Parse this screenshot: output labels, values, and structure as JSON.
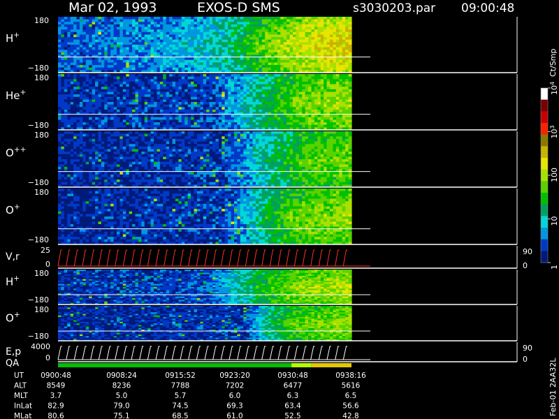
{
  "header": {
    "date": "Mar 02, 1993",
    "instrument": "EXOS-D SMS",
    "file": "s3030203.par",
    "time": "09:00:48"
  },
  "colorbar": {
    "unit": "Ct/Smp",
    "ticks": [
      {
        "label": "1",
        "value": 1
      },
      {
        "label": "10",
        "value": 10
      },
      {
        "label": "100",
        "value": 100
      },
      {
        "label": "10",
        "sup": "3",
        "value": 1000
      },
      {
        "label": "10",
        "sup": "4",
        "value": 10000
      }
    ],
    "stops": [
      {
        "color": "#001a7a"
      },
      {
        "color": "#0039c8"
      },
      {
        "color": "#0096e0"
      },
      {
        "color": "#00d7d7"
      },
      {
        "color": "#00a060"
      },
      {
        "color": "#00c000"
      },
      {
        "color": "#5ad200"
      },
      {
        "color": "#a8e100"
      },
      {
        "color": "#e6e600"
      },
      {
        "color": "#c8b400"
      },
      {
        "color": "#8c7800"
      },
      {
        "color": "#ff2000"
      },
      {
        "color": "#c80000"
      },
      {
        "color": "#780000"
      },
      {
        "color": "#ffffff"
      }
    ]
  },
  "chart_data": {
    "type": "heatmap",
    "x_range": [
      0,
      44
    ],
    "panels": [
      {
        "id": "h-plus",
        "label": "H",
        "sup": "+",
        "ymax": "180",
        "ymin": "−180",
        "profile": [
          [
            0,
            1.4
          ],
          [
            14,
            2.0
          ],
          [
            22,
            3.0
          ],
          [
            27,
            4.5
          ],
          [
            31,
            6.2
          ],
          [
            36,
            7.6
          ],
          [
            40,
            8.4
          ],
          [
            44,
            8.6
          ]
        ],
        "line_y": 0.72
      },
      {
        "id": "he-plus",
        "label": "He",
        "sup": "+",
        "ymax": "180",
        "ymin": "−180",
        "profile": [
          [
            0,
            0.6
          ],
          [
            22,
            0.9
          ],
          [
            27,
            2.6
          ],
          [
            31,
            4.6
          ],
          [
            36,
            6.2
          ],
          [
            40,
            6.8
          ],
          [
            44,
            7.0
          ]
        ],
        "line_y": 0.72
      },
      {
        "id": "o-plus-plus",
        "label": "O",
        "sup": "++",
        "ymax": "180",
        "ymin": "−180",
        "profile": [
          [
            0,
            0.5
          ],
          [
            24,
            0.8
          ],
          [
            28,
            2.2
          ],
          [
            32,
            4.2
          ],
          [
            36,
            5.6
          ],
          [
            40,
            6.2
          ],
          [
            44,
            6.4
          ]
        ],
        "line_y": 0.72
      },
      {
        "id": "o-plus",
        "label": "O",
        "sup": "+",
        "ymax": "180",
        "ymin": "−180",
        "profile": [
          [
            0,
            0.5
          ],
          [
            24,
            0.8
          ],
          [
            27,
            2.0
          ],
          [
            31,
            4.5
          ],
          [
            35,
            6.0
          ],
          [
            40,
            6.6
          ],
          [
            44,
            6.8
          ]
        ],
        "line_y": 0.72
      }
    ],
    "vr_panel": {
      "label": "V,r",
      "ymax": "25",
      "ymin": "0",
      "right_max": "90",
      "right_min": "0"
    },
    "lower_panels": [
      {
        "id": "h-plus-2",
        "label": "H",
        "sup": "+",
        "ymax": "180",
        "ymin": "−180",
        "profile": [
          [
            0,
            0.6
          ],
          [
            22,
            1.2
          ],
          [
            27,
            3.5
          ],
          [
            31,
            5.4
          ],
          [
            36,
            6.8
          ],
          [
            44,
            7.4
          ]
        ],
        "line_y": 0.72
      },
      {
        "id": "o-plus-2",
        "label": "O",
        "sup": "+",
        "ymax": "180",
        "ymin": "−180",
        "profile": [
          [
            0,
            0.5
          ],
          [
            28,
            0.8
          ],
          [
            31,
            3.8
          ],
          [
            35,
            5.8
          ],
          [
            40,
            6.6
          ],
          [
            44,
            6.8
          ]
        ],
        "line_y": 0.72
      }
    ],
    "ep_panel": {
      "label": "E,p",
      "ymax": "4000",
      "ymin": "0",
      "right_max": "90",
      "right_min": "0"
    },
    "qa": {
      "label": "QA",
      "segments": [
        {
          "from": 0,
          "to": 35,
          "color": "#00c000"
        },
        {
          "from": 35,
          "to": 38,
          "color": "#b6ff00"
        },
        {
          "from": 38,
          "to": 44,
          "color": "#e6c800"
        }
      ]
    },
    "ephemeris": {
      "rows": [
        {
          "name": "UT",
          "values": [
            "0900:48",
            "0908:24",
            "0915:52",
            "0923:20",
            "0930:48",
            "0938:16"
          ]
        },
        {
          "name": "ALT",
          "values": [
            "8549",
            "8236",
            "7788",
            "7202",
            "6477",
            "5616"
          ]
        },
        {
          "name": "MLT",
          "values": [
            "3.7",
            "5.0",
            "5.7",
            "6.0",
            "6.3",
            "6.5"
          ]
        },
        {
          "name": "InLat",
          "values": [
            "82.9",
            "79.0",
            "74.5",
            "69.3",
            "63.4",
            "56.6"
          ]
        },
        {
          "name": "MLat",
          "values": [
            "80.6",
            "75.1",
            "68.5",
            "61.0",
            "52.5",
            "42.8"
          ]
        }
      ]
    },
    "footer": "Feb-01 2AA32L"
  }
}
